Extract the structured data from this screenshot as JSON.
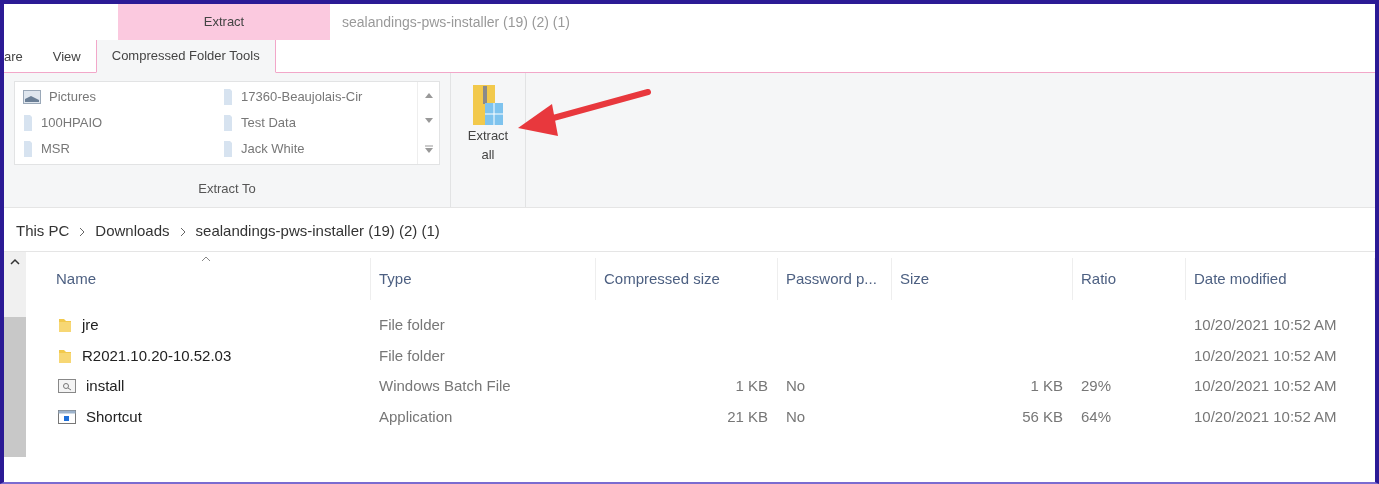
{
  "window": {
    "title": "sealandings-pws-installer (19) (2) (1)"
  },
  "contextual_tab": {
    "label": "Extract"
  },
  "tabs": [
    {
      "label": "are",
      "selected": false
    },
    {
      "label": "View",
      "selected": false
    },
    {
      "label": "Compressed Folder Tools",
      "selected": true
    }
  ],
  "ribbon": {
    "extract_to": {
      "items": [
        {
          "label": "Pictures",
          "kind": "pictures"
        },
        {
          "label": "100HPAIO",
          "kind": "folder"
        },
        {
          "label": "MSR",
          "kind": "folder"
        },
        {
          "label": "17360-Beaujolais-Cir",
          "kind": "folder"
        },
        {
          "label": "Test Data",
          "kind": "folder"
        },
        {
          "label": "Jack White",
          "kind": "folder"
        }
      ],
      "group_label": "Extract To"
    },
    "extract_all": {
      "label": "Extract all"
    }
  },
  "breadcrumb": [
    "This PC",
    "Downloads",
    "sealandings-pws-installer (19) (2) (1)"
  ],
  "table": {
    "columns": [
      {
        "label": "Name",
        "sorted": true,
        "kind": "text"
      },
      {
        "label": "Type",
        "sorted": false,
        "kind": "text"
      },
      {
        "label": "Compressed size",
        "sorted": false,
        "kind": "number"
      },
      {
        "label": "Password p...",
        "sorted": false,
        "kind": "text"
      },
      {
        "label": "Size",
        "sorted": false,
        "kind": "number"
      },
      {
        "label": "Ratio",
        "sorted": false,
        "kind": "text"
      },
      {
        "label": "Date modified",
        "sorted": false,
        "kind": "text"
      }
    ],
    "rows": [
      {
        "kind": "folder",
        "cells": [
          "jre",
          "File folder",
          "",
          "",
          "",
          "",
          "10/20/2021 10:52 AM"
        ]
      },
      {
        "kind": "folder",
        "cells": [
          "R2021.10.20-10.52.03",
          "File folder",
          "",
          "",
          "",
          "",
          "10/20/2021 10:52 AM"
        ]
      },
      {
        "kind": "batch",
        "cells": [
          "install",
          "Windows Batch File",
          "1 KB",
          "No",
          "1 KB",
          "29%",
          "10/20/2021 10:52 AM"
        ]
      },
      {
        "kind": "app",
        "cells": [
          "Shortcut",
          "Application",
          "21 KB",
          "No",
          "56 KB",
          "64%",
          "10/20/2021 10:52 AM"
        ]
      }
    ]
  }
}
